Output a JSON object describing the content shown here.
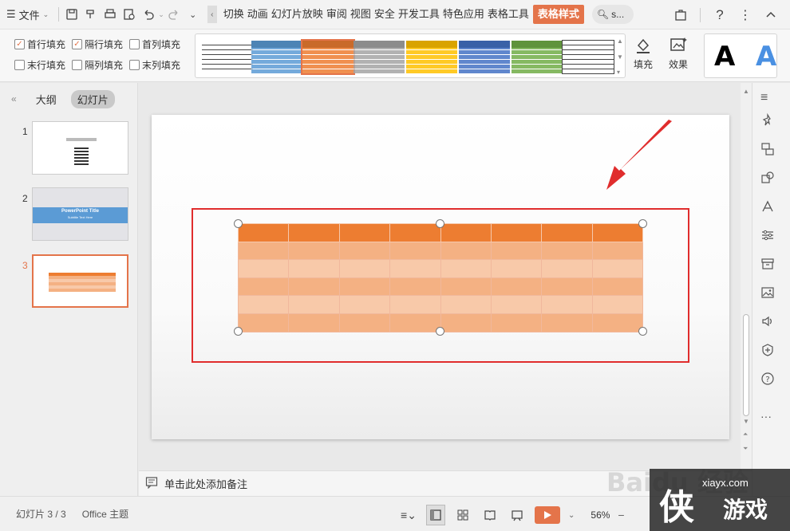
{
  "menubar": {
    "file_label": "文件",
    "tabs": [
      "切换",
      "动画",
      "幻灯片放映",
      "审阅",
      "视图",
      "安全",
      "开发工具",
      "特色应用",
      "表格工具"
    ],
    "active_tab": "表格样式",
    "search_text": "s..."
  },
  "ribbon": {
    "checkboxes": [
      {
        "label": "首行填充",
        "checked": true
      },
      {
        "label": "隔行填充",
        "checked": true
      },
      {
        "label": "首列填充",
        "checked": false
      },
      {
        "label": "末行填充",
        "checked": false
      },
      {
        "label": "隔列填充",
        "checked": false
      },
      {
        "label": "末列填充",
        "checked": false
      }
    ],
    "table_style_colors": [
      "#ffffff",
      "#5b9bd5",
      "#ed7d31",
      "#a5a5a5",
      "#ffc000",
      "#4472c4",
      "#70ad47",
      "#ffffff"
    ],
    "fill_label": "填充",
    "effect_label": "效果",
    "text_style_sample": "A"
  },
  "left_panel": {
    "tab_outline": "大纲",
    "tab_slides": "幻灯片",
    "slides": [
      {
        "number": "1"
      },
      {
        "number": "2",
        "title": "PowerPoint Title",
        "subtitle": "Subtitle Text Here"
      },
      {
        "number": "3"
      }
    ],
    "active_slide": "3"
  },
  "canvas": {
    "table": {
      "rows": 6,
      "cols": 8,
      "header_color": "#ed7d31",
      "band_color_1": "#f4b183",
      "band_color_2": "#f8c9a9"
    },
    "annotation_color": "#e02d2d"
  },
  "notes": {
    "placeholder": "单击此处添加备注"
  },
  "statusbar": {
    "slide_info": "幻灯片 3 / 3",
    "theme": "Office 主题",
    "zoom": "56%"
  },
  "watermark": {
    "site": "xiayx.com",
    "logo": "侠",
    "name": "游戏",
    "baidu": "Baidu 经验"
  },
  "colors": {
    "accent": "#e4744a"
  }
}
